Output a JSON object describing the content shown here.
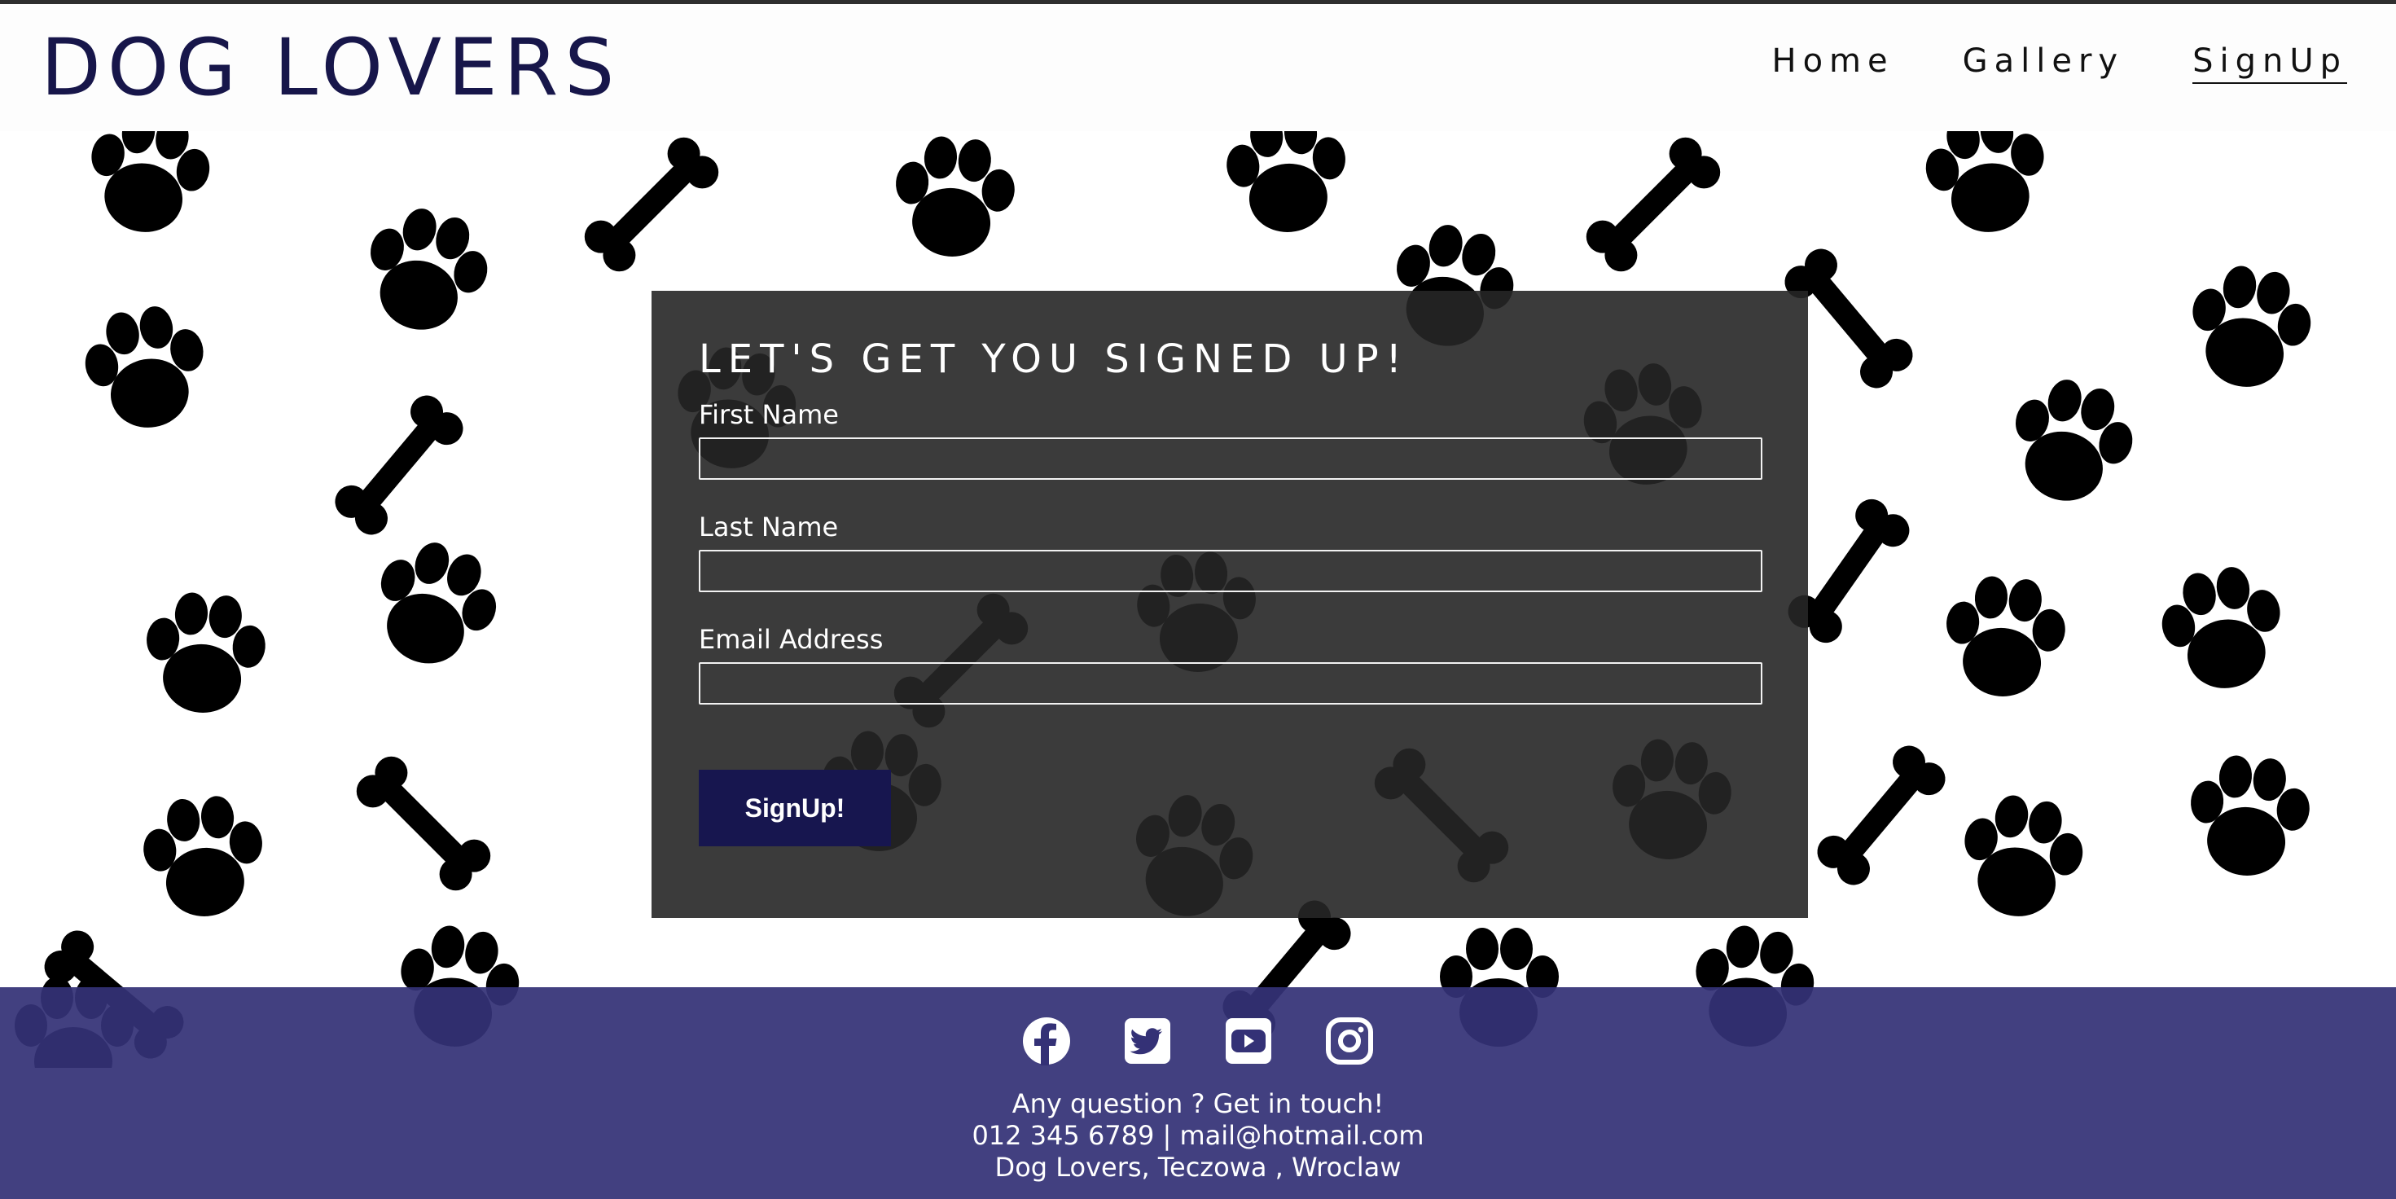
{
  "header": {
    "logo": "DOG LOVERS",
    "nav": [
      {
        "label": "Home"
      },
      {
        "label": "Gallery"
      },
      {
        "label": "SignUp",
        "active": true
      }
    ]
  },
  "form": {
    "title": "LET'S GET YOU SIGNED UP!",
    "first_name_label": "First Name",
    "first_name_value": "",
    "last_name_label": "Last Name",
    "last_name_value": "",
    "email_label": "Email Address",
    "email_value": "",
    "submit_label": "SignUp!"
  },
  "footer": {
    "socials": [
      "facebook-icon",
      "twitter-icon",
      "youtube-icon",
      "instagram-icon"
    ],
    "line1": "Any question ? Get in touch!",
    "line2": "012 345 6789 | mail@hotmail.com",
    "line3": "Dog Lovers, Teczowa , Wroclaw"
  },
  "colors": {
    "brand": "#17164a",
    "button": "#17164f",
    "footer": "#343176",
    "form_bg": "#262626"
  }
}
